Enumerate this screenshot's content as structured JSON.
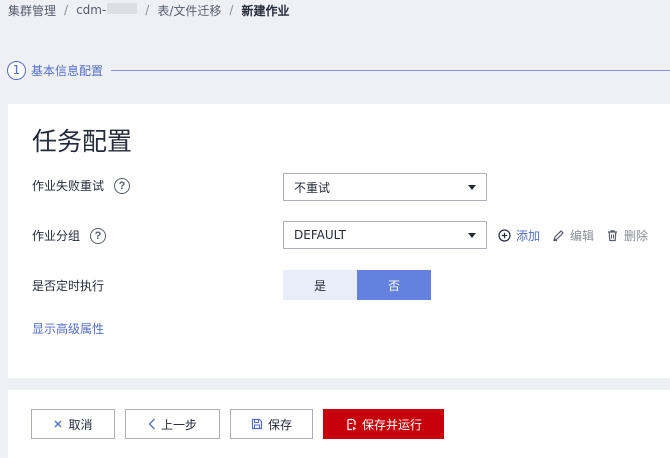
{
  "breadcrumb": {
    "items": [
      "集群管理",
      "cdm-",
      "表/文件迁移",
      "新建作业"
    ]
  },
  "step": {
    "number": "1",
    "label": "基本信息配置"
  },
  "card": {
    "title": "任务配置"
  },
  "form": {
    "retry": {
      "label": "作业失败重试",
      "value": "不重试"
    },
    "group": {
      "label": "作业分组",
      "value": "DEFAULT",
      "add_label": "添加",
      "edit_label": "编辑",
      "delete_label": "删除"
    },
    "scheduled": {
      "label": "是否定时执行",
      "option_yes": "是",
      "option_no": "否",
      "selected": "否"
    },
    "advanced_link": "显示高级属性"
  },
  "footer": {
    "cancel_label": "取消",
    "prev_label": "上一步",
    "save_label": "保存",
    "save_run_label": "保存并运行"
  },
  "colors": {
    "accent": "#526ecc",
    "toggle_on": "#6481e0",
    "toggle_off": "#e9edfa",
    "danger": "#c7000b"
  }
}
